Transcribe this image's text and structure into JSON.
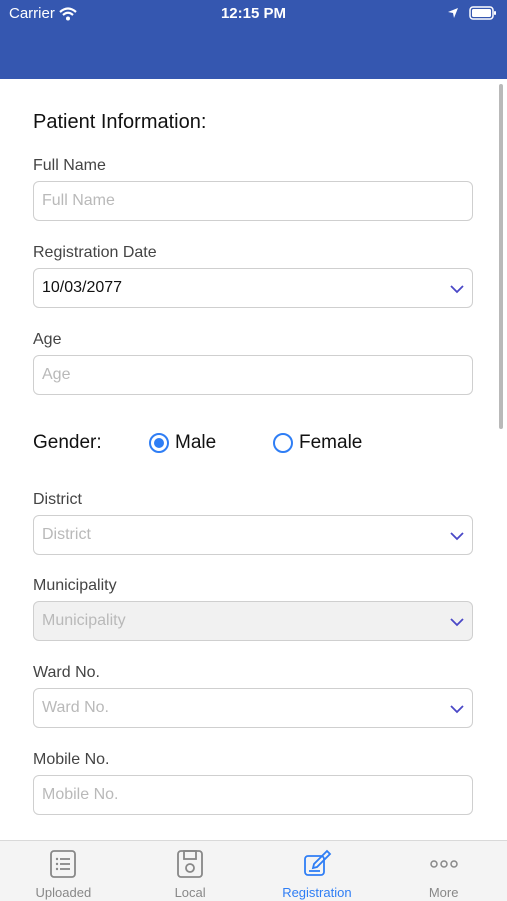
{
  "status": {
    "carrier": "Carrier",
    "time": "12:15 PM"
  },
  "form": {
    "title": "Patient Information:",
    "full_name": {
      "label": "Full Name",
      "placeholder": "Full Name"
    },
    "registration_date": {
      "label": "Registration Date",
      "value": "10/03/2077"
    },
    "age": {
      "label": "Age",
      "placeholder": "Age"
    },
    "gender": {
      "label": "Gender:",
      "options": [
        "Male",
        "Female"
      ],
      "selected": "Male"
    },
    "district": {
      "label": "District",
      "placeholder": "District"
    },
    "municipality": {
      "label": "Municipality",
      "placeholder": "Municipality"
    },
    "ward": {
      "label": "Ward No.",
      "placeholder": "Ward No."
    },
    "mobile": {
      "label": "Mobile No.",
      "placeholder": "Mobile No."
    }
  },
  "tabbar": {
    "items": [
      {
        "label": "Uploaded",
        "icon": "list-icon"
      },
      {
        "label": "Local",
        "icon": "save-icon"
      },
      {
        "label": "Registration",
        "icon": "edit-icon"
      },
      {
        "label": "More",
        "icon": "more-icon"
      }
    ],
    "active": "Registration"
  },
  "colors": {
    "header": "#3557b0",
    "accent": "#2f7ef5"
  }
}
